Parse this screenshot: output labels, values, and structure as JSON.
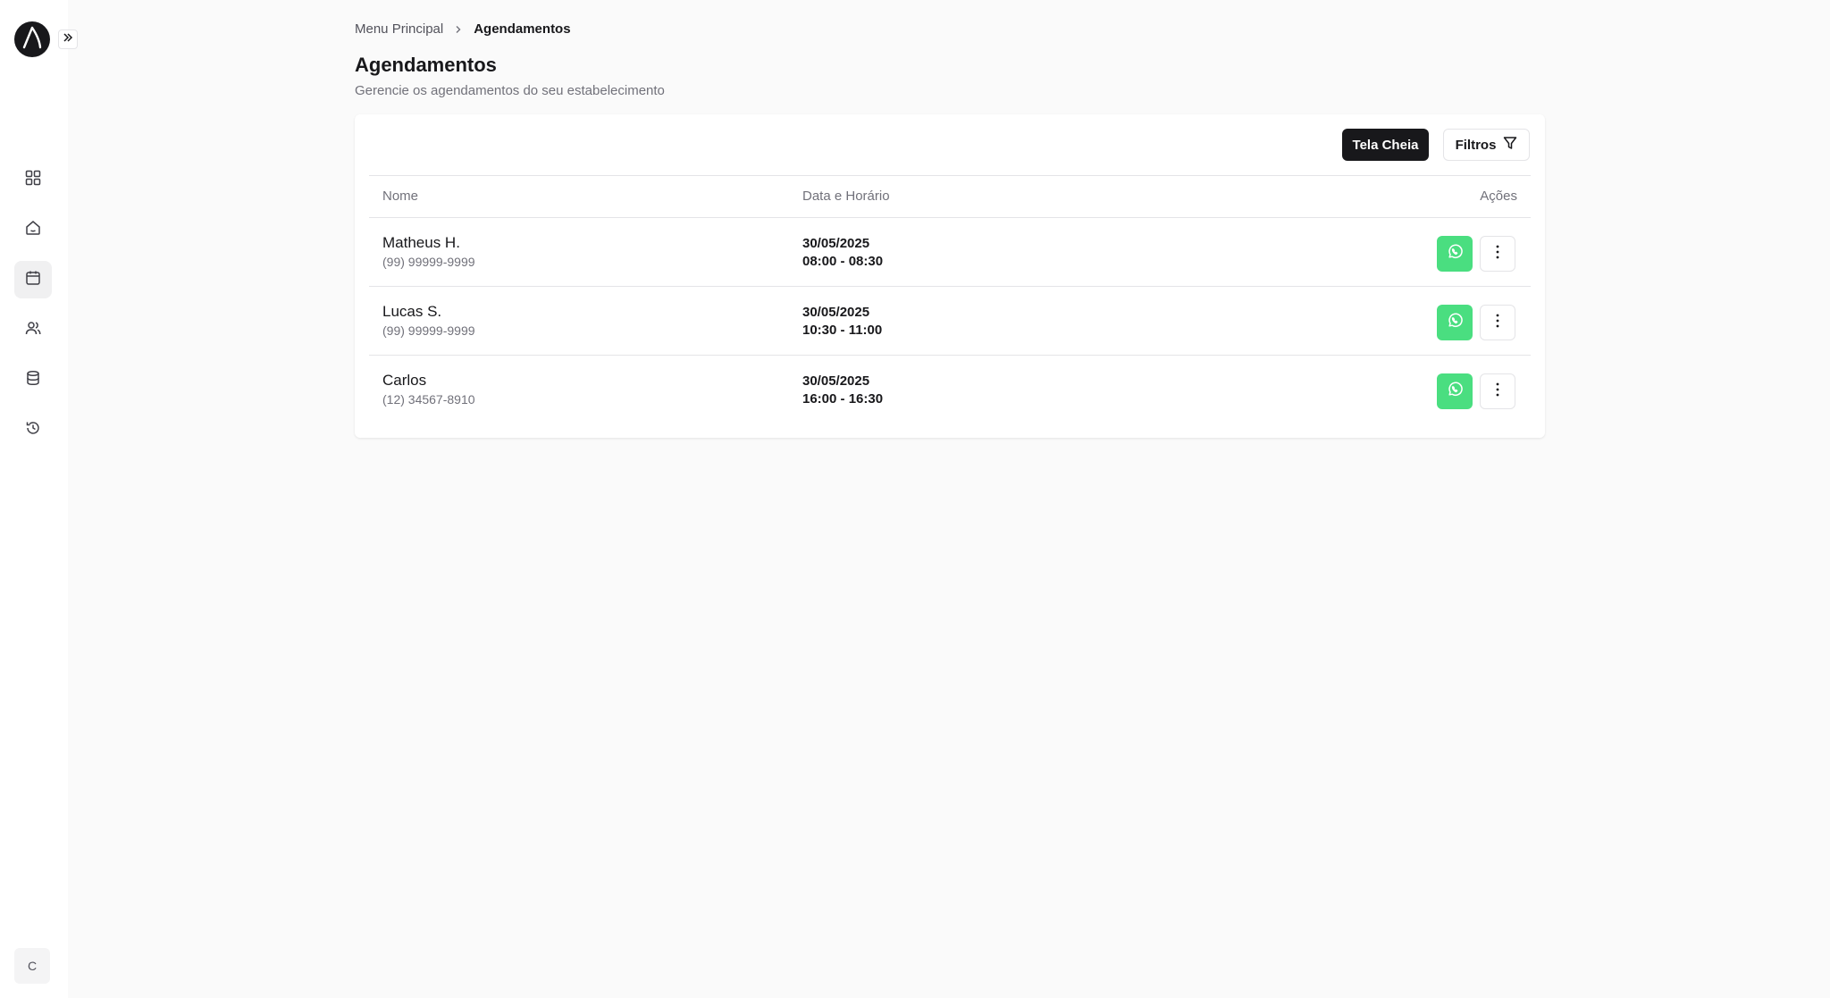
{
  "sidebar": {
    "logo_icon": "delta-logo-icon",
    "expand_icon": "chevrons-right-icon",
    "items": [
      {
        "icon": "grid-icon"
      },
      {
        "icon": "home-icon"
      },
      {
        "icon": "calendar-icon",
        "active": true
      },
      {
        "icon": "users-icon"
      },
      {
        "icon": "database-icon"
      },
      {
        "icon": "history-icon"
      }
    ],
    "avatar_initial": "C"
  },
  "breadcrumb": {
    "root": "Menu Principal",
    "current": "Agendamentos"
  },
  "page": {
    "title": "Agendamentos",
    "subtitle": "Gerencie os agendamentos do seu estabelecimento"
  },
  "toolbar": {
    "fullscreen_label": "Tela Cheia",
    "filters_label": "Filtros"
  },
  "table": {
    "columns": {
      "name": "Nome",
      "datetime": "Data e Horário",
      "actions": "Ações"
    },
    "rows": [
      {
        "name": "Matheus H.",
        "phone": "(99) 99999-9999",
        "date": "30/05/2025",
        "time": "08:00 - 08:30"
      },
      {
        "name": "Lucas S.",
        "phone": "(99) 99999-9999",
        "date": "30/05/2025",
        "time": "10:30 - 11:00"
      },
      {
        "name": "Carlos",
        "phone": "(12) 34567-8910",
        "date": "30/05/2025",
        "time": "16:00 - 16:30"
      }
    ]
  },
  "colors": {
    "whatsapp": "#4ade80",
    "primary_dark": "#18181b"
  }
}
